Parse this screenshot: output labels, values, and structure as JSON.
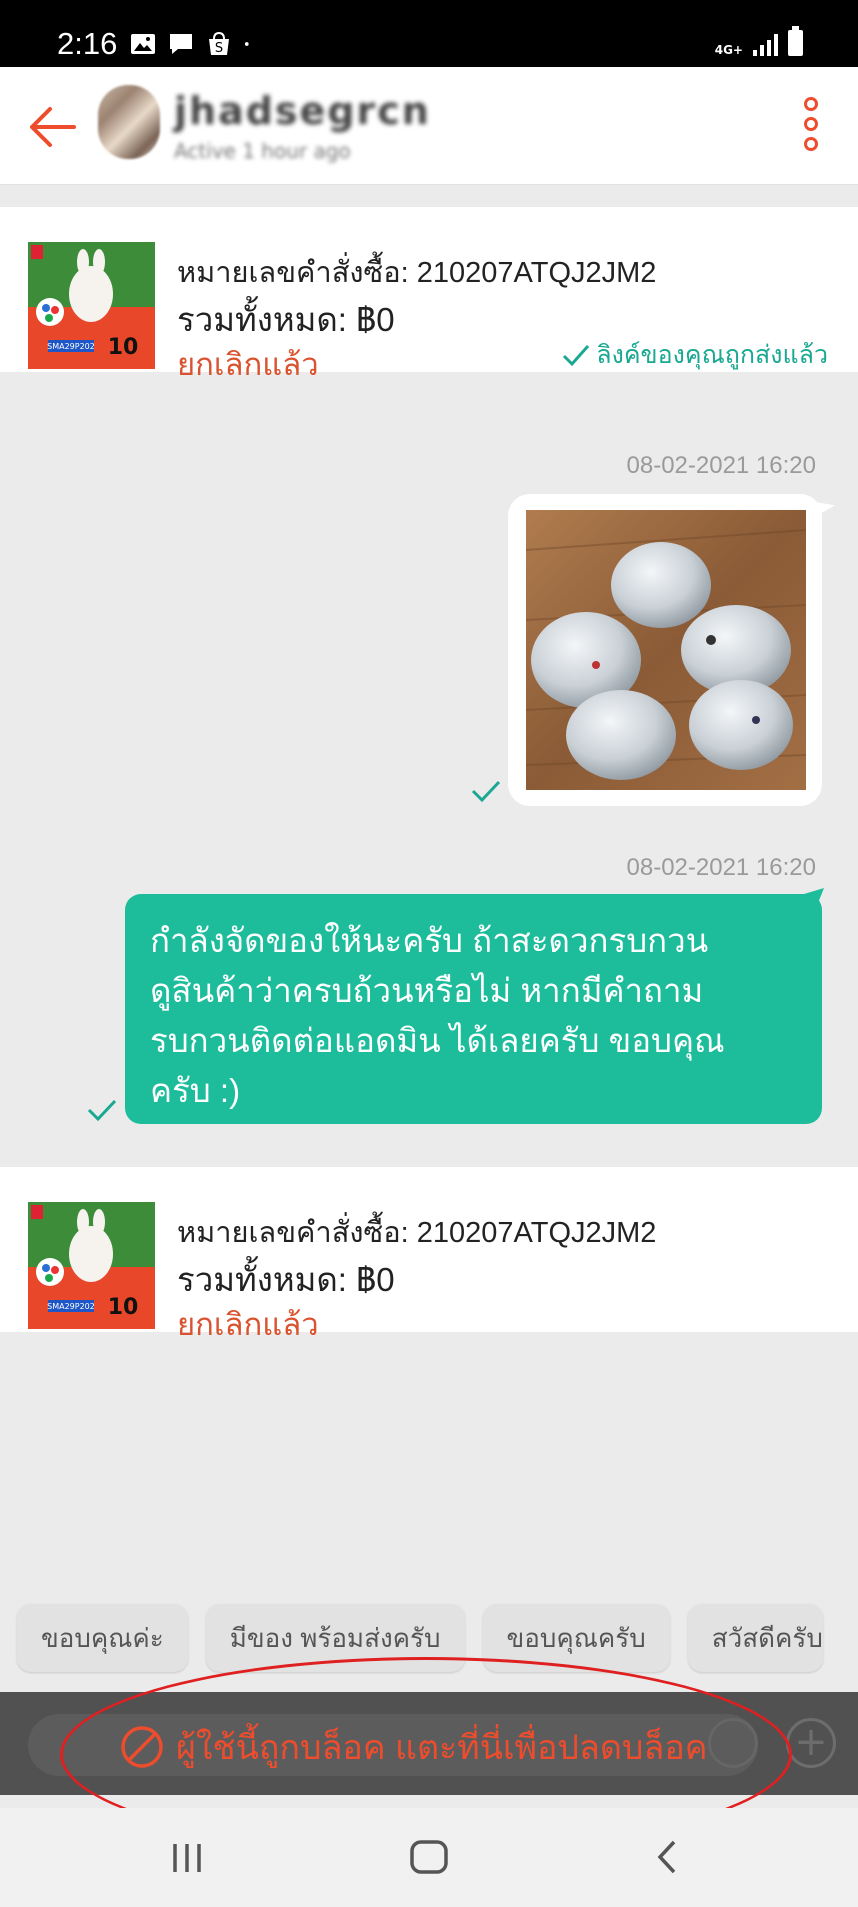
{
  "status_bar": {
    "time": "2:16",
    "network": "4G+",
    "icons": [
      "gallery-icon",
      "message-icon",
      "shopee-icon",
      "dot-icon",
      "signal-icon",
      "battery-icon"
    ]
  },
  "header": {
    "username": "jhadsegrcn",
    "subtitle": "Active 1 hour ago"
  },
  "orders": [
    {
      "order_number": "หมายเลขคำสั่งซื้อ: 210207ATQJ2JM2",
      "total": "รวมทั้งหมด: ฿0",
      "status": "ยกเลิกแล้ว",
      "link_status": "ลิงค์ของคุณถูกส่งแล้ว",
      "thumb_code": "SMA29P202",
      "thumb_number": "10"
    },
    {
      "order_number": "หมายเลขคำสั่งซื้อ: 210207ATQJ2JM2",
      "total": "รวมทั้งหมด: ฿0",
      "status": "ยกเลิกแล้ว",
      "thumb_code": "SMA29P202",
      "thumb_number": "10"
    }
  ],
  "messages": [
    {
      "timestamp": "08-02-2021 16:20",
      "type": "image"
    },
    {
      "timestamp": "08-02-2021 16:20",
      "type": "text",
      "lines": [
        "กำลังจัดของให้นะครับ ถ้าสะดวกรบกวน",
        "ดูสินค้าว่าครบถ้วนหรือไม่ หากมีคำถาม",
        "รบกวนติดต่อแอดมิน ได้เลยครับ ขอบคุณ",
        "ครับ :)"
      ]
    }
  ],
  "quick_replies": [
    "ขอบคุณค่ะ",
    "มีของ พร้อมส่งครับ",
    "ขอบคุณครับ",
    "สวัสดีครับ"
  ],
  "blocked_bar": {
    "text": "ผู้ใช้นี้ถูกบล็อค แตะที่นี่เพื่อปลดบล็อค"
  },
  "colors": {
    "accent": "#ee4d2d",
    "bubble": "#1dbd9c",
    "link_ok": "#1aa892",
    "annotation": "#e02020"
  }
}
